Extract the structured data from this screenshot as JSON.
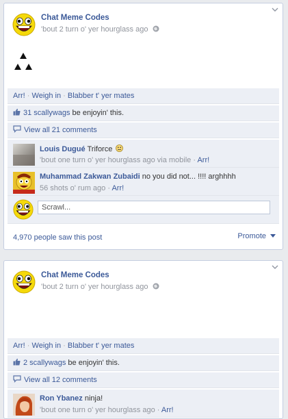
{
  "post1": {
    "author": "Chat Meme Codes",
    "time": "'bout 2 turn o' yer hourglass ago",
    "actions": {
      "arr": "Arr!",
      "weigh": "Weigh in",
      "blabber": "Blabber t' yer mates",
      "sep": " · "
    },
    "likes": {
      "count": "31 scallywags",
      "suffix": " be enjoyin' this."
    },
    "view_all": "View all 21 comments",
    "comments": [
      {
        "name": "Louis Dugué",
        "text": "Triforce",
        "time": "'bout one turn o' yer hourglass ago via mobile",
        "arr": "Arr!"
      },
      {
        "name": "Muhammad Zakwan Zubaidi",
        "text": "no you did not... !!!! arghhhh",
        "time": "56 shots o' rum ago",
        "arr": "Arr!"
      }
    ],
    "write_placeholder": "Scrawl...",
    "seen": "4,970 people saw this post",
    "promote": "Promote"
  },
  "post2": {
    "author": "Chat Meme Codes",
    "time": "'bout 2 turn o' yer hourglass ago",
    "actions": {
      "arr": "Arr!",
      "weigh": "Weigh in",
      "blabber": "Blabber t' yer mates",
      "sep": " · "
    },
    "likes": {
      "count": "2 scallywags",
      "suffix": " be enjoyin' this."
    },
    "view_all": "View all 12 comments",
    "comments": [
      {
        "name": "Ron Ybanez",
        "text": "ninja!",
        "time": "'bout one turn o' yer hourglass ago",
        "arr": "Arr!"
      }
    ]
  },
  "colors": {
    "link": "#3b5998",
    "panel": "#eceff5",
    "page": "#e9ebee",
    "muted": "#90949c"
  },
  "icons": [
    "awesome-face-avatar",
    "globe-icon",
    "chevron-down-icon",
    "thumbs-up-icon",
    "comment-bubble-icon",
    "smiley-icon",
    "caret-down-icon"
  ]
}
